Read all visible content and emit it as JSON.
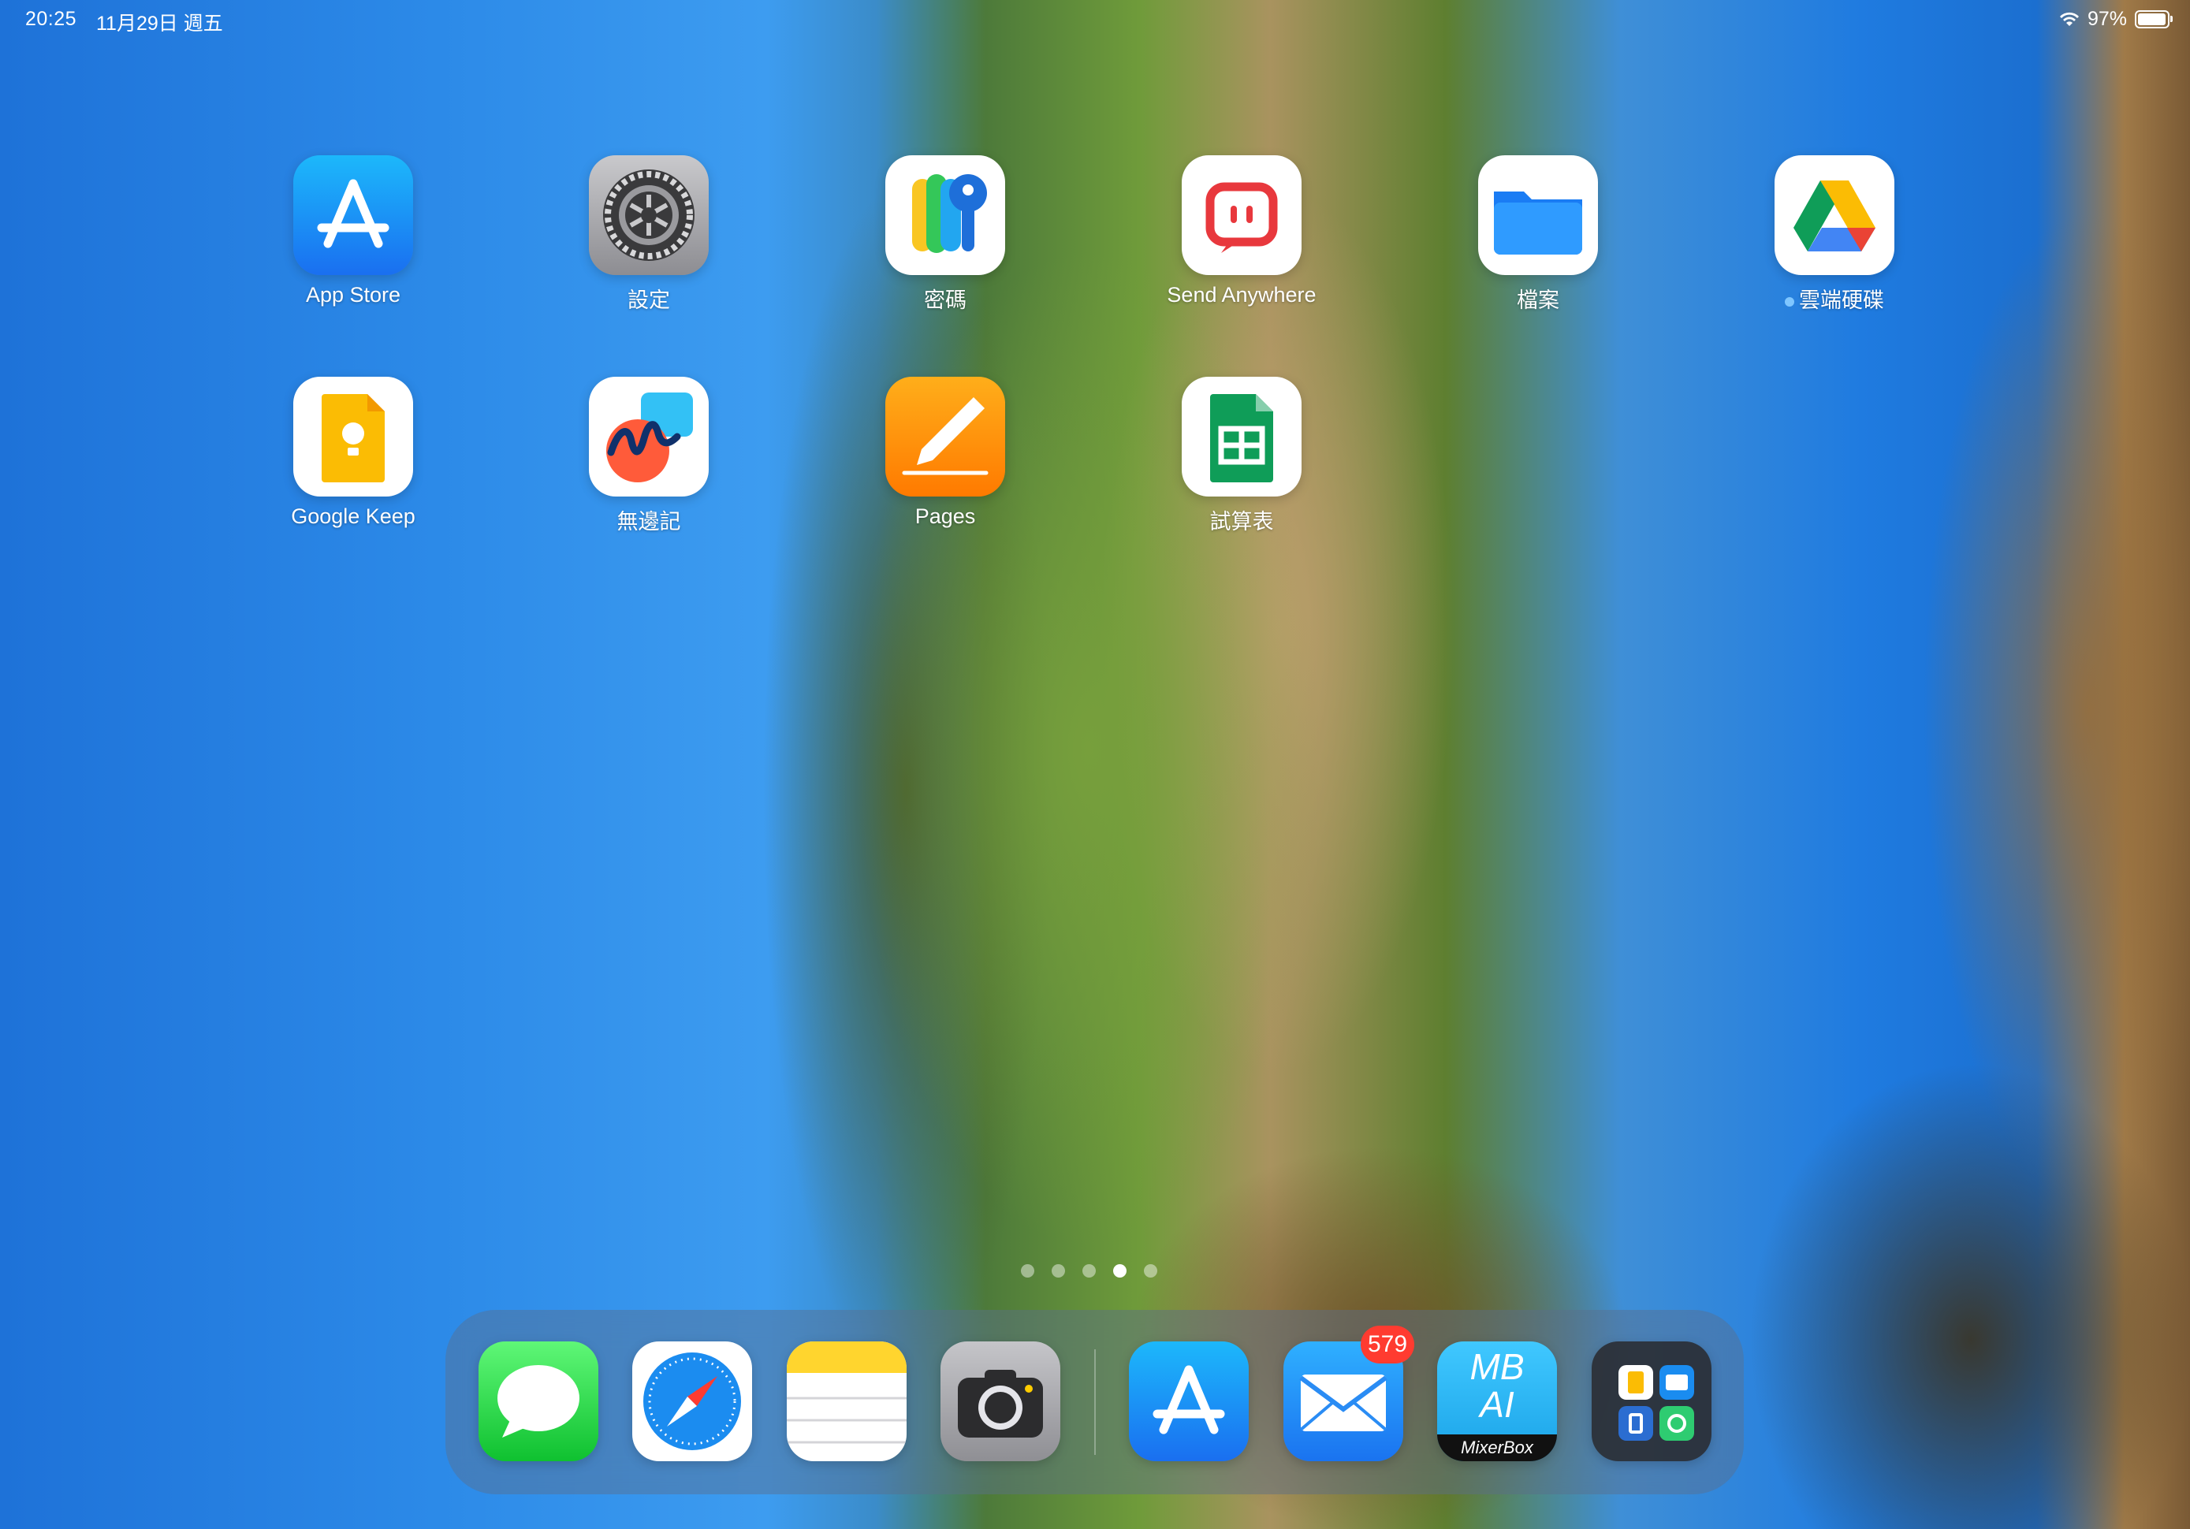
{
  "status_bar": {
    "time": "20:25",
    "date": "11月29日 週五",
    "battery_text": "97%",
    "battery_level": 0.97
  },
  "apps": [
    {
      "label": "App Store",
      "icon": "app-store-icon"
    },
    {
      "label": "設定",
      "icon": "gear-icon"
    },
    {
      "label": "密碼",
      "icon": "passwords-keys-icon"
    },
    {
      "label": "Send Anywhere",
      "icon": "send-anywhere-icon"
    },
    {
      "label": "檔案",
      "icon": "folder-icon"
    },
    {
      "label": "雲端硬碟",
      "icon": "google-drive-icon",
      "new_indicator": true
    },
    {
      "label": "Google Keep",
      "icon": "google-keep-icon"
    },
    {
      "label": "無邊記",
      "icon": "freeform-icon"
    },
    {
      "label": "Pages",
      "icon": "pages-icon"
    },
    {
      "label": "試算表",
      "icon": "google-sheets-icon"
    }
  ],
  "page_indicator": {
    "count": 5,
    "active": 4
  },
  "dock": {
    "apps": [
      {
        "name": "Messages",
        "icon": "messages-icon"
      },
      {
        "name": "Safari",
        "icon": "safari-compass-icon"
      },
      {
        "name": "Notes",
        "icon": "notes-icon"
      },
      {
        "name": "Camera",
        "icon": "camera-icon"
      },
      {
        "name": "App Store",
        "icon": "app-store-icon"
      },
      {
        "name": "Mail",
        "icon": "mail-icon",
        "badge": "579"
      },
      {
        "name": "MixerBox AI",
        "icon": "mixerbox-ai-icon",
        "line1": "MB",
        "line2": "AI",
        "brand": "MixerBox"
      },
      {
        "name": "App Library",
        "icon": "app-library-icon"
      }
    ]
  },
  "colors": {
    "badge": "#ff3b30",
    "app_store_blue": "#1a8cf0",
    "messages_green": "#34c759"
  }
}
